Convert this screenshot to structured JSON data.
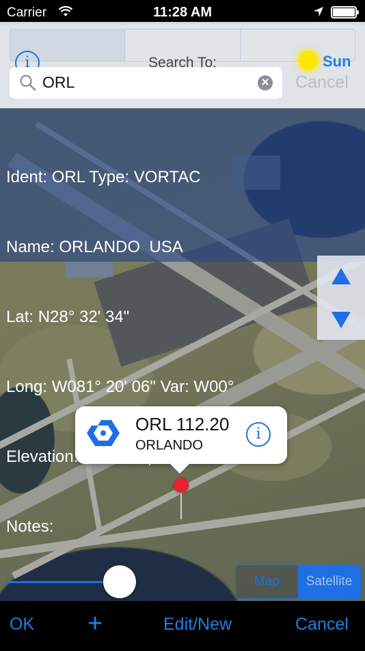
{
  "status_bar": {
    "carrier": "Carrier",
    "time": "11:28 AM"
  },
  "header": {
    "title": "Search To:",
    "sun_label": "Sun",
    "info_icon": "info-icon",
    "sun_color": "#ffe600"
  },
  "search": {
    "value": "ORL",
    "cancel_label": "Cancel"
  },
  "details": {
    "lines": [
      "Ident: ORL Type: VORTAC",
      "Name: ORLANDO  USA",
      "Lat: N28° 32' 34\"",
      "Long: W081° 20' 06\" Var: W00°",
      "Elevation: 102' Freq: 112.20",
      "Notes:"
    ]
  },
  "callout": {
    "title": "ORL 112.20",
    "subtitle": "ORLANDO",
    "icon": "vortac-icon"
  },
  "map_type": {
    "options": [
      "Map",
      "Satellite"
    ],
    "selected": "Satellite"
  },
  "toolbar": {
    "ok_label": "OK",
    "add_label": "+",
    "edit_label": "Edit/New",
    "cancel_label": "Cancel"
  },
  "colors": {
    "accent": "#1e7fe8",
    "pin": "#e8202a",
    "overlay": "#264687"
  }
}
